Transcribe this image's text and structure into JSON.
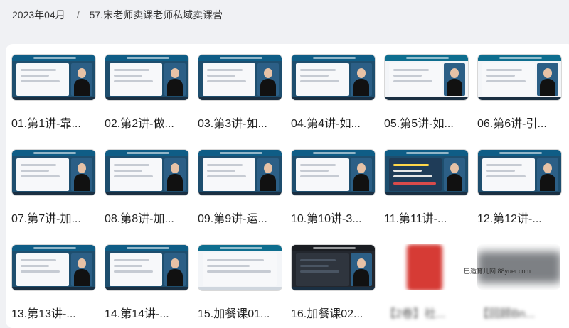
{
  "breadcrumb": {
    "date": "2023年04月",
    "separator": "/",
    "folder": "57.宋老师卖课老师私域卖课营"
  },
  "watermark": "巴适育儿网 88yuer.com",
  "cards": [
    {
      "label": "01.第1讲-靠..."
    },
    {
      "label": "02.第2讲-做..."
    },
    {
      "label": "03.第3讲-如..."
    },
    {
      "label": "04.第4讲-如..."
    },
    {
      "label": "05.第5讲-如..."
    },
    {
      "label": "06.第6讲-引..."
    },
    {
      "label": "07.第7讲-加..."
    },
    {
      "label": "08.第8讲-加..."
    },
    {
      "label": "09.第9讲-运..."
    },
    {
      "label": "10.第10讲-3..."
    },
    {
      "label": "11.第11讲-..."
    },
    {
      "label": "12.第12讲-..."
    },
    {
      "label": "13.第13讲-..."
    },
    {
      "label": "14.第14讲-..."
    },
    {
      "label": "15.加餐课01..."
    },
    {
      "label": "16.加餐课02..."
    },
    {
      "label": "【2卷】社..."
    },
    {
      "label": "【回顾Bn..."
    }
  ]
}
